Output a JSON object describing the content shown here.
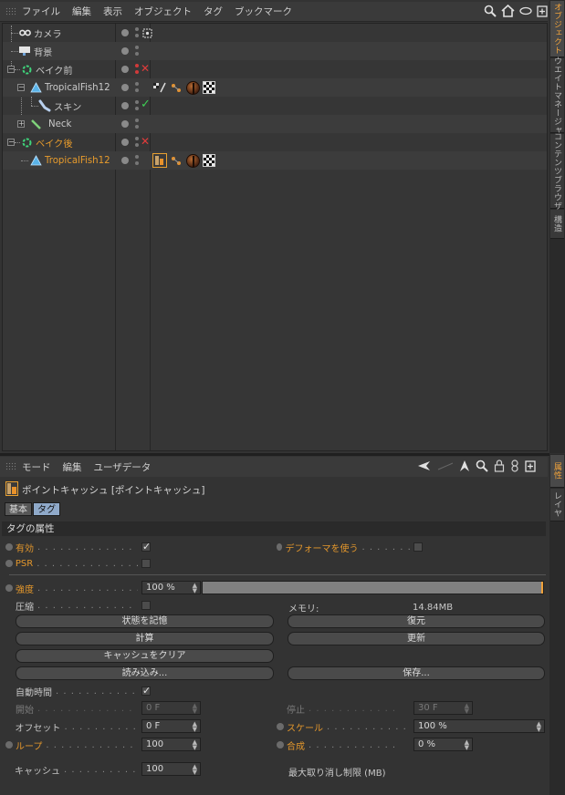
{
  "object_manager": {
    "menu": [
      "ファイル",
      "編集",
      "表示",
      "オブジェクト",
      "タグ",
      "ブックマーク"
    ],
    "tool_icons": [
      "search-icon",
      "home-icon",
      "eye-icon",
      "new-window-icon"
    ],
    "objects": [
      {
        "name": "カメラ",
        "icon": "camera-icon",
        "depth": 0,
        "orange": false,
        "red_x": false
      },
      {
        "name": "背景",
        "icon": "background-icon",
        "depth": 0,
        "orange": false,
        "red_x": false
      },
      {
        "name": "ベイク前",
        "icon": "null-icon",
        "depth": 0,
        "orange": false,
        "red_x": true
      },
      {
        "name": "TropicalFish12",
        "icon": "polygon-icon",
        "depth": 1,
        "orange": false,
        "red_x": false
      },
      {
        "name": "スキン",
        "icon": "skin-icon",
        "depth": 2,
        "orange": false,
        "red_x": false,
        "green_check": true
      },
      {
        "name": "Neck",
        "icon": "joint-icon",
        "depth": 1,
        "orange": false,
        "red_x": false
      },
      {
        "name": "ベイク後",
        "icon": "null-icon",
        "depth": 0,
        "orange": true,
        "red_x": true
      },
      {
        "name": "TropicalFish12",
        "icon": "polygon-icon",
        "depth": 1,
        "orange": true,
        "red_x": false
      }
    ],
    "side_tabs": [
      "オブジェクト",
      "ウエイトマネージャ",
      "コンテンツブラウザ",
      "構造"
    ]
  },
  "attribute_manager": {
    "menu": [
      "モード",
      "編集",
      "ユーザデータ"
    ],
    "tool_icons": [
      "back-arrow-icon",
      "forward-arrow-icon",
      "search-icon",
      "lock-icon",
      "link-icon",
      "new-window-icon"
    ],
    "title": "ポイントキャッシュ [ポイントキャッシュ]",
    "tabs": [
      "基本",
      "タグ"
    ],
    "section_title": "タグの属性",
    "side_tabs": [
      "属性",
      "レイヤ"
    ],
    "props": {
      "enabled_label": "有効",
      "use_deformer_label": "デフォーマを使う",
      "psr_label": "PSR",
      "strength_label": "強度",
      "strength_value": "100 %",
      "strength_fraction": 1.0,
      "compress_label": "圧縮",
      "memory_label": "メモリ:",
      "memory_value": "14.84MB",
      "btn_store_state": "状態を記憶",
      "btn_restore": "復元",
      "btn_calculate": "計算",
      "btn_update": "更新",
      "btn_clear_cache": "キャッシュをクリア",
      "btn_load": "読み込み...",
      "btn_save": "保存...",
      "auto_time_label": "自動時間",
      "start_label": "開始",
      "start_value": "0 F",
      "stop_label": "停止",
      "stop_value": "30 F",
      "offset_label": "オフセット",
      "offset_value": "0 F",
      "scale_label": "スケール",
      "scale_value": "100 %",
      "loop_label": "ループ",
      "loop_value": "100",
      "blend_label": "合成",
      "blend_value": "0 %",
      "cache_label": "キャッシュ",
      "cache_value": "100",
      "max_undo_label": "最大取り消し制限 (MB)"
    },
    "checks": {
      "enabled": true,
      "use_deformer": false,
      "psr": false,
      "compress": false,
      "auto_time": true
    }
  },
  "colors": {
    "accent_orange": "#e79b2c",
    "tab_blue": "#8fa9c9"
  }
}
